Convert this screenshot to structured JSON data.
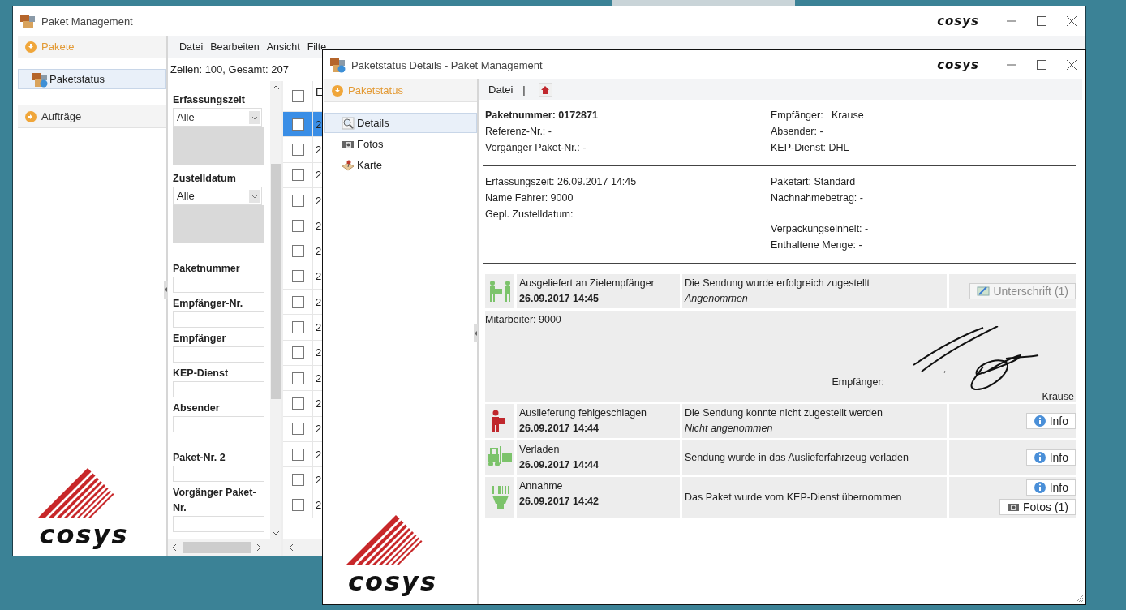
{
  "main_window": {
    "title": "Paket Management",
    "brand": "cosys",
    "sidebar": {
      "groups": [
        {
          "label": "Pakete",
          "expanded": true,
          "children": [
            {
              "label": "Paketstatus",
              "selected": true
            }
          ]
        },
        {
          "label": "Aufträge",
          "expanded": false
        }
      ],
      "logo_text": "cosys"
    },
    "menu": [
      "Datei",
      "Bearbeiten",
      "Ansicht",
      "Filte"
    ],
    "summary": "Zeilen: 100, Gesamt: 207",
    "filter_groups": [
      [
        {
          "kind": "select",
          "label": "Erfassungszeit",
          "value": "Alle"
        },
        {
          "kind": "select",
          "label": "Zustelldatum",
          "value": "Alle"
        }
      ],
      [
        {
          "kind": "text",
          "label": "Paketnummer"
        },
        {
          "kind": "text",
          "label": "Empfänger-Nr."
        },
        {
          "kind": "text",
          "label": "Empfänger"
        },
        {
          "kind": "text",
          "label": "KEP-Dienst"
        },
        {
          "kind": "text",
          "label": "Absender"
        }
      ],
      [
        {
          "kind": "text",
          "label": "Paket-Nr. 2"
        },
        {
          "kind": "text",
          "label": "Vorgänger Paket-Nr."
        }
      ]
    ],
    "table": {
      "header": "E",
      "header_checked": false,
      "rows": [
        {
          "selected": true,
          "checked": false,
          "cell": "2"
        },
        {
          "selected": false,
          "checked": false,
          "cell": "2"
        },
        {
          "selected": false,
          "checked": false,
          "cell": "2"
        },
        {
          "selected": false,
          "checked": false,
          "cell": "2"
        },
        {
          "selected": false,
          "checked": false,
          "cell": "2"
        },
        {
          "selected": false,
          "checked": false,
          "cell": "2"
        },
        {
          "selected": false,
          "checked": false,
          "cell": "2"
        },
        {
          "selected": false,
          "checked": false,
          "cell": "2"
        },
        {
          "selected": false,
          "checked": false,
          "cell": "2"
        },
        {
          "selected": false,
          "checked": false,
          "cell": "2"
        },
        {
          "selected": false,
          "checked": false,
          "cell": "2"
        },
        {
          "selected": false,
          "checked": false,
          "cell": "2"
        },
        {
          "selected": false,
          "checked": false,
          "cell": "2"
        },
        {
          "selected": false,
          "checked": false,
          "cell": "2"
        },
        {
          "selected": false,
          "checked": false,
          "cell": "2"
        },
        {
          "selected": false,
          "checked": false,
          "cell": "2"
        }
      ]
    }
  },
  "details_window": {
    "title": "Paketstatus Details - Paket Management",
    "brand": "cosys",
    "nav": {
      "header": "Paketstatus",
      "expanded": true,
      "items": [
        {
          "kind": "details",
          "label": "Details",
          "selected": true
        },
        {
          "kind": "photos",
          "label": "Fotos",
          "selected": false
        },
        {
          "kind": "map",
          "label": "Karte",
          "selected": false
        }
      ],
      "logo_text": "cosys"
    },
    "toolbar": {
      "menu": "Datei",
      "separator": "|"
    },
    "sections": [
      {
        "left": [
          [
            {
              "text": "Paketnummer: 0172871",
              "bold": true
            },
            {
              "text": "Referenz-Nr.: -",
              "bold": false
            },
            {
              "text": "Vorgänger Paket-Nr.: -",
              "bold": false
            }
          ]
        ],
        "right": [
          [
            {
              "text": "Empfänger:   Krause",
              "bold": false
            },
            {
              "text": "Absender: -",
              "bold": false
            },
            {
              "text": "KEP-Dienst: DHL",
              "bold": false
            }
          ]
        ]
      },
      {
        "left": [
          [
            {
              "text": "Erfassungszeit: 26.09.2017 14:45",
              "bold": false
            },
            {
              "text": "Name Fahrer: 9000",
              "bold": false
            },
            {
              "text": "Gepl. Zustelldatum:",
              "bold": false
            }
          ]
        ],
        "right": [
          [
            {
              "text": "Paketart: Standard",
              "bold": false
            },
            {
              "text": "Nachnahmebetrag: -",
              "bold": false
            }
          ],
          [
            {
              "text": "Verpackungseinheit: -",
              "bold": false
            },
            {
              "text": "Enthaltene Menge: -",
              "bold": false
            }
          ]
        ]
      }
    ],
    "events": [
      {
        "kind": "delivered",
        "color": "#7cc36b",
        "title": "Ausgeliefert an Zielempfänger",
        "time": "26.09.2017 14:45",
        "description": "Die Sendung wurde erfolgreich zugestellt",
        "note": "Angenommen",
        "buttons": [
          {
            "kind": "signature",
            "label": "Unterschrift (1)",
            "disabled": true
          }
        ],
        "signature": {
          "employee": "Mitarbeiter: 9000",
          "recipient_label": "Empfänger:",
          "recipient_name": "Krause"
        }
      },
      {
        "kind": "failed",
        "color": "#c0272d",
        "title": "Auslieferung fehlgeschlagen",
        "time": "26.09.2017 14:44",
        "description": "Die Sendung konnte nicht zugestellt werden",
        "note": "Nicht angenommen",
        "buttons": [
          {
            "kind": "info",
            "label": "Info",
            "disabled": false
          }
        ]
      },
      {
        "kind": "loaded",
        "color": "#7cc36b",
        "title": "Verladen",
        "time": "26.09.2017 14:44",
        "description": "Sendung wurde in das Auslieferfahrzeug verladen",
        "buttons": [
          {
            "kind": "info",
            "label": "Info",
            "disabled": false
          }
        ]
      },
      {
        "kind": "accepted",
        "color": "#7cc36b",
        "title": "Annahme",
        "time": "26.09.2017 14:42",
        "description": "Das Paket wurde vom KEP-Dienst übernommen",
        "buttons": [
          {
            "kind": "info",
            "label": "Info",
            "disabled": false
          },
          {
            "kind": "photos",
            "label": "Fotos (1)",
            "disabled": false
          }
        ]
      }
    ]
  }
}
